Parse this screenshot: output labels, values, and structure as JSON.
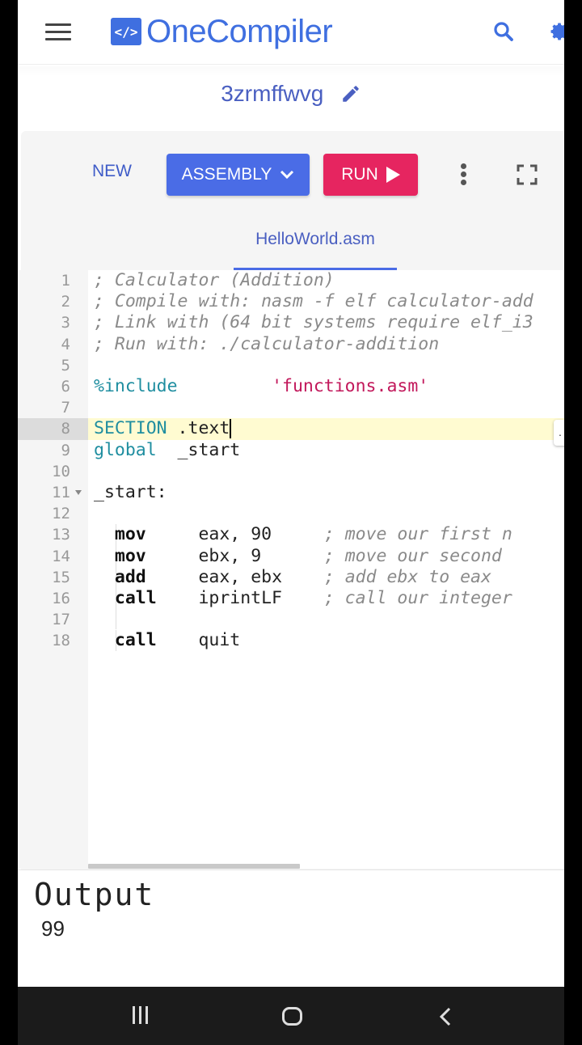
{
  "header": {
    "logo_mark": "</>",
    "logo_text": "OneCompiler",
    "icons": [
      "menu-icon",
      "search-icon",
      "gear-icon"
    ]
  },
  "snippet": {
    "title": "3zrmffwvg",
    "edit_icon": "pencil-icon"
  },
  "toolbar": {
    "new_label": "NEW",
    "language_label": "ASSEMBLY",
    "run_label": "RUN",
    "icons": [
      "chevron-down-icon",
      "play-icon",
      "more-vert-icon",
      "fullscreen-icon"
    ]
  },
  "tabs": [
    {
      "label": "HelloWorld.asm",
      "active": true
    }
  ],
  "editor": {
    "active_line": 8,
    "lines": [
      {
        "n": "1",
        "text": "; Calculator (Addition)"
      },
      {
        "n": "2",
        "text": "; Compile with: nasm -f elf calculator-add"
      },
      {
        "n": "3",
        "text": "; Link with (64 bit systems require elf_i3"
      },
      {
        "n": "4",
        "text": "; Run with: ./calculator-addition"
      },
      {
        "n": "5",
        "text": ""
      },
      {
        "n": "6",
        "text": "%include         'functions.asm'"
      },
      {
        "n": "7",
        "text": ""
      },
      {
        "n": "8",
        "text": "SECTION .text"
      },
      {
        "n": "9",
        "text": "global  _start"
      },
      {
        "n": "10",
        "text": ""
      },
      {
        "n": "11",
        "text": "_start:"
      },
      {
        "n": "12",
        "text": ""
      },
      {
        "n": "13",
        "text": "    mov     eax, 90     ; move our first n"
      },
      {
        "n": "14",
        "text": "    mov     ebx, 9      ; move our second "
      },
      {
        "n": "15",
        "text": "    add     eax, ebx    ; add ebx to eax"
      },
      {
        "n": "16",
        "text": "    call    iprintLF    ; call our integer"
      },
      {
        "n": "17",
        "text": ""
      },
      {
        "n": "18",
        "text": "    call    quit"
      }
    ],
    "tokens": {
      "l1": "; Calculator (Addition)",
      "l2": "; Compile with: nasm -f elf calculator-add",
      "l3": "; Link with (64 bit systems require elf_i3",
      "l4": "; Run with: ./calculator-addition",
      "l6_dir": "%include",
      "l6_str": "'functions.asm'",
      "l8_dir": "SECTION",
      "l8_rest": " .text",
      "l9_dir": "global",
      "l9_rest": "  _start",
      "l11": "_start:",
      "l13_op": "mov",
      "l13_args": "eax, 90",
      "l13_cmt": "; move our first n",
      "l14_op": "mov",
      "l14_args": "ebx, 9",
      "l14_cmt": "; move our second ",
      "l15_op": "add",
      "l15_args": "eax, ebx",
      "l15_cmt": "; add ebx to eax",
      "l16_op": "call",
      "l16_args": "iprintLF",
      "l16_cmt": "; call our integer",
      "l18_op": "call",
      "l18_args": "quit"
    },
    "side_tip": "."
  },
  "output": {
    "title": "Output",
    "value": "99"
  },
  "navbar": {
    "icons": [
      "recents-icon",
      "home-icon",
      "back-icon"
    ]
  },
  "colors": {
    "brand": "#3f6fe0",
    "language_button": "#4a6ce6",
    "run_button": "#e62560",
    "active_line": "#fffbd1",
    "directive": "#1f8ea0",
    "string": "#c2185b",
    "comment": "#8a8a8a"
  }
}
